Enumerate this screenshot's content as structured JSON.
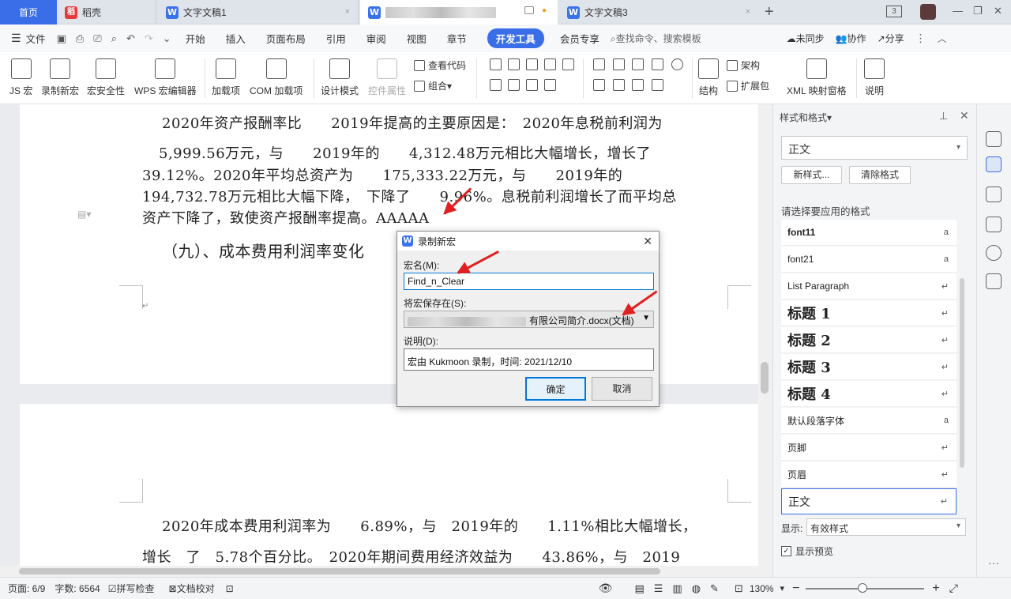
{
  "tabs": {
    "home": "首页",
    "daoke": "稻壳",
    "doc1": "文字文稿1",
    "doc3": "文字文稿3",
    "doc3_close": "×",
    "doc1_close": "×",
    "dot": "●"
  },
  "window": {
    "num_badge": "3",
    "minimize": "—",
    "restore": "❐",
    "close": "✕"
  },
  "menu": {
    "file": "文件",
    "items": [
      "开始",
      "插入",
      "页面布局",
      "引用",
      "审阅",
      "视图",
      "章节"
    ],
    "active": "开发工具",
    "member": "会员专享",
    "search": "查找命令、搜索模板",
    "sync": "未同步",
    "collab": "协作",
    "share": "分享"
  },
  "ribbon": {
    "js_macro": "JS 宏",
    "record_macro": "录制新宏",
    "macro_security": "宏安全性",
    "wps_macro_editor": "WPS 宏编辑器",
    "addins": "加载项",
    "com_addins": "COM 加载项",
    "design_mode": "设计模式",
    "control_props": "控件属性",
    "view_code": "查看代码",
    "group": "组合",
    "structure": "结构",
    "architecture": "架构",
    "expansion_pack": "扩展包",
    "xml_mapping": "XML 映射窗格",
    "help": "说明"
  },
  "doc": {
    "p1_l1": "2020年资产报酬率比　　2019年提高的主要原因是：　2020年息税前利润为",
    "p1_l2": "5,999.56万元，与　　2019年的　　4,312.48万元相比大幅增长，增长了",
    "p1_l3": "39.12%。2020年平均总资产为　　175,333.22万元，与　　2019年的",
    "p1_l4": "194,732.78万元相比大幅下降，　下降了　　9.96%。息税前利润增长了而平均总",
    "p1_l5": "资产下降了，致使资产报酬率提高。AAAAA",
    "heading": "（九）、成本费用利润率变化",
    "p2_l1": "2020年成本费用利润率为　　6.89%，与　2019年的　　1.11%相比大幅增长，",
    "p2_l2": "增长　了　5.78个百分比。　2020年期间费用经济效益为　　43.86%，与　2019"
  },
  "dialog": {
    "title": "录制新宏",
    "macro_name_label": "宏名(M):",
    "macro_name_value": "Find_n_Clear",
    "save_in_label": "将宏保存在(S):",
    "save_in_value": "有限公司简介.docx(文档)",
    "description_label": "说明(D):",
    "description_value": "宏由 Kukmoon 录制，时间: 2021/12/10",
    "ok": "确定",
    "cancel": "取消"
  },
  "style_pane": {
    "title": "样式和格式",
    "current_style": "正文",
    "new_style": "新样式...",
    "clear_format": "清除格式",
    "prompt": "请选择要应用的格式",
    "styles": [
      {
        "name": "font11",
        "mark": "a",
        "big": false
      },
      {
        "name": "font21",
        "mark": "a",
        "big": false
      },
      {
        "name": "List Paragraph",
        "mark": "↵",
        "big": false
      },
      {
        "name": "标题 1",
        "mark": "↵",
        "big": true
      },
      {
        "name": "标题 2",
        "mark": "↵",
        "big": true
      },
      {
        "name": "标题 3",
        "mark": "↵",
        "big": true
      },
      {
        "name": "标题 4",
        "mark": "↵",
        "big": true
      },
      {
        "name": "默认段落字体",
        "mark": "a",
        "big": false
      },
      {
        "name": "页脚",
        "mark": "↵",
        "big": false
      },
      {
        "name": "页眉",
        "mark": "↵",
        "big": false
      },
      {
        "name": "正文",
        "mark": "↵",
        "big": false
      }
    ],
    "display_label": "显示:",
    "display_value": "有效样式",
    "show_preview": "显示预览"
  },
  "status": {
    "page": "页面: 6/9",
    "words": "字数: 6564",
    "spell": "拼写检查",
    "proof": "文档校对",
    "zoom": "130%"
  },
  "colors": {
    "accent": "#3a6ee8",
    "arrow": "#e02020"
  }
}
